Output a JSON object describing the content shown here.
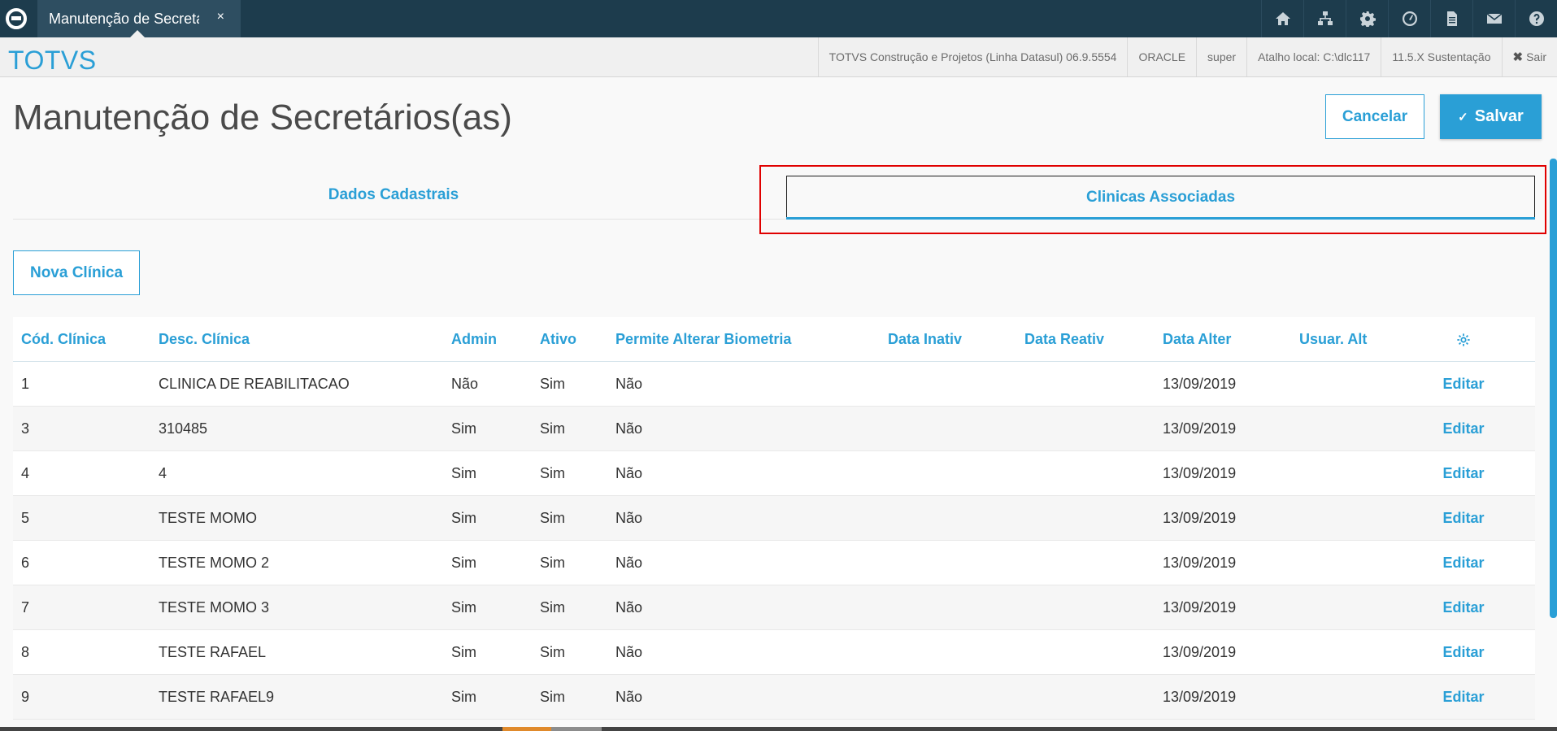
{
  "topbar": {
    "tab_title": "Manutenção de Secretários(as)",
    "tab_close": "×",
    "icons": [
      "home-icon",
      "sitemap-icon",
      "settings-gear-icon",
      "dashboard-clock-icon",
      "document-icon",
      "mail-icon",
      "help-icon"
    ]
  },
  "subbar": {
    "brand": "TOTVS",
    "product": "TOTVS Construção e Projetos (Linha Datasul) 06.9.5554",
    "database": "ORACLE",
    "user": "super",
    "shortcut": "Atalho local: C:\\dlc117",
    "version": "11.5.X Sustentação",
    "logout": "Sair",
    "logout_icon": "✖"
  },
  "page": {
    "title": "Manutenção de Secretários(as)",
    "cancel_label": "Cancelar",
    "save_label": "Salvar",
    "save_icon": "✓"
  },
  "tabs": [
    {
      "label": "Dados Cadastrais",
      "active": false
    },
    {
      "label": "Clinicas Associadas",
      "active": true
    }
  ],
  "new_button_label": "Nova Clínica",
  "table": {
    "headers": [
      "Cód. Clínica",
      "Desc. Clínica",
      "Admin",
      "Ativo",
      "Permite Alterar Biometria",
      "Data Inativ",
      "Data Reativ",
      "Data Alter",
      "Usuar. Alt"
    ],
    "settings_icon": "gear-icon",
    "edit_label": "Editar",
    "rows": [
      [
        "1",
        "CLINICA DE REABILITACAO",
        "Não",
        "Sim",
        "Não",
        "",
        "",
        "13/09/2019",
        ""
      ],
      [
        "3",
        "310485",
        "Sim",
        "Sim",
        "Não",
        "",
        "",
        "13/09/2019",
        ""
      ],
      [
        "4",
        "4",
        "Sim",
        "Sim",
        "Não",
        "",
        "",
        "13/09/2019",
        ""
      ],
      [
        "5",
        "TESTE MOMO",
        "Sim",
        "Sim",
        "Não",
        "",
        "",
        "13/09/2019",
        ""
      ],
      [
        "6",
        "TESTE MOMO 2",
        "Sim",
        "Sim",
        "Não",
        "",
        "",
        "13/09/2019",
        ""
      ],
      [
        "7",
        "TESTE MOMO 3",
        "Sim",
        "Sim",
        "Não",
        "",
        "",
        "13/09/2019",
        ""
      ],
      [
        "8",
        "TESTE RAFAEL",
        "Sim",
        "Sim",
        "Não",
        "",
        "",
        "13/09/2019",
        ""
      ],
      [
        "9",
        "TESTE RAFAEL9",
        "Sim",
        "Sim",
        "Não",
        "",
        "",
        "13/09/2019",
        ""
      ]
    ]
  },
  "colors": {
    "accent": "#2a9fd6",
    "topbar": "#1d3c4d",
    "highlight": "#e00000"
  }
}
